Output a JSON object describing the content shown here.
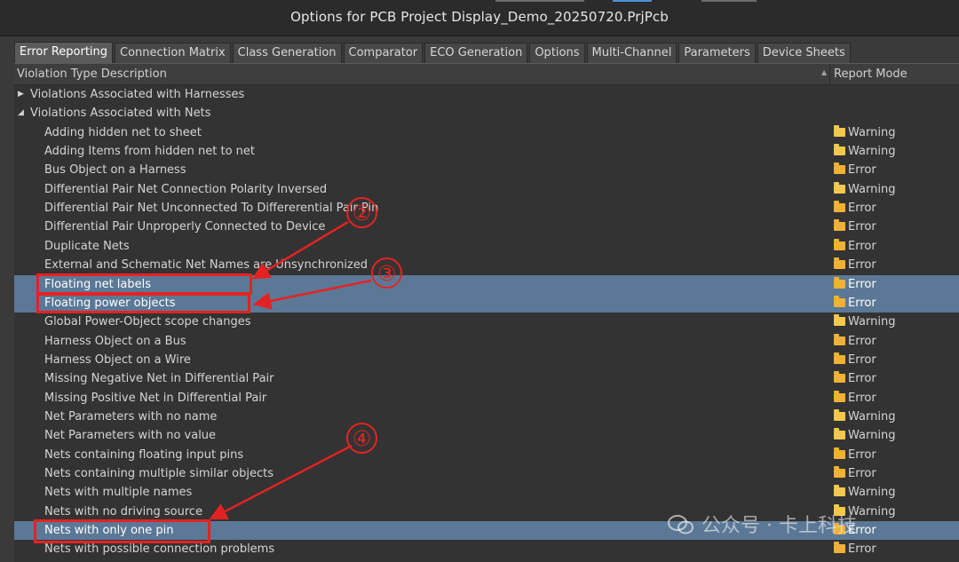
{
  "window": {
    "title": "Options for PCB Project Display_Demo_20250720.PrjPcb"
  },
  "tabs": [
    "Error Reporting",
    "Connection Matrix",
    "Class Generation",
    "Comparator",
    "ECO Generation",
    "Options",
    "Multi-Channel",
    "Parameters",
    "Device Sheets"
  ],
  "table": {
    "col_description": "Violation Type Description",
    "col_mode": "Report Mode",
    "groups": [
      {
        "label": "Violations Associated with Harnesses",
        "expanded": false
      },
      {
        "label": "Violations Associated with Nets",
        "expanded": true
      }
    ],
    "rows": [
      {
        "label": "Adding hidden net to sheet",
        "mode": "Warning"
      },
      {
        "label": "Adding Items from hidden net to net",
        "mode": "Warning"
      },
      {
        "label": "Bus Object on a Harness",
        "mode": "Error"
      },
      {
        "label": "Differential Pair Net Connection Polarity Inversed",
        "mode": "Warning"
      },
      {
        "label": "Differential Pair Net Unconnected To Differerential Pair Pin",
        "mode": "Error"
      },
      {
        "label": "Differential Pair Unproperly Connected to Device",
        "mode": "Error"
      },
      {
        "label": "Duplicate Nets",
        "mode": "Error"
      },
      {
        "label": "External and Schematic Net Names are Unsynchronized",
        "mode": "Error"
      },
      {
        "label": "Floating net labels",
        "mode": "Error",
        "selected": true
      },
      {
        "label": "Floating power objects",
        "mode": "Error",
        "selected": true
      },
      {
        "label": "Global Power-Object scope changes",
        "mode": "Warning"
      },
      {
        "label": "Harness Object on a Bus",
        "mode": "Error"
      },
      {
        "label": "Harness Object on a Wire",
        "mode": "Error"
      },
      {
        "label": "Missing Negative Net in Differential Pair",
        "mode": "Error"
      },
      {
        "label": "Missing Positive Net in Differential Pair",
        "mode": "Error"
      },
      {
        "label": "Net Parameters with no name",
        "mode": "Warning"
      },
      {
        "label": "Net Parameters with no value",
        "mode": "Warning"
      },
      {
        "label": "Nets containing floating input pins",
        "mode": "Error"
      },
      {
        "label": "Nets containing multiple similar objects",
        "mode": "Error"
      },
      {
        "label": "Nets with multiple names",
        "mode": "Warning"
      },
      {
        "label": "Nets with no driving source",
        "mode": "Warning"
      },
      {
        "label": "Nets with only one pin",
        "mode": "Error",
        "selected": true
      },
      {
        "label": "Nets with possible connection problems",
        "mode": "Error"
      }
    ]
  },
  "annotations": {
    "markers": [
      "②",
      "③",
      "④"
    ],
    "color": "#e52222"
  },
  "watermark": {
    "text": "公众号 · 卡上科技"
  },
  "colors": {
    "selected_row": "#5b7896",
    "warning_folder": "#f2c94c",
    "error_folder": "#f0b134"
  }
}
